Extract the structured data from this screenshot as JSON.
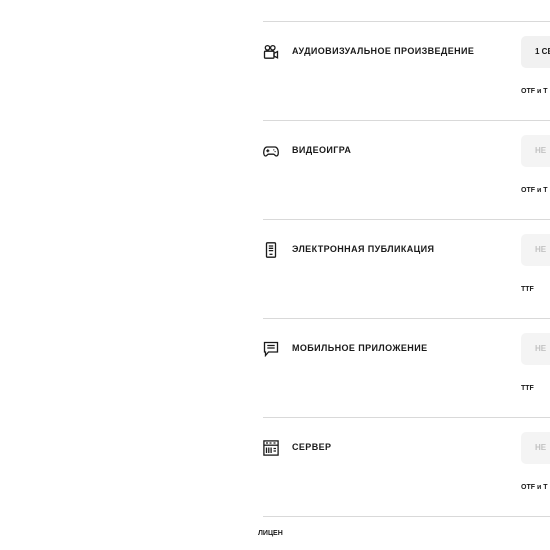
{
  "license_rows": [
    {
      "id": "audiovisual",
      "icon": "video-camera-icon",
      "label": "АУДИОВИЗУАЛЬНОЕ ПРОИЗВЕДЕНИЕ",
      "select_value": "1 СЕ",
      "select_disabled": false,
      "format": "OTF и T"
    },
    {
      "id": "videogame",
      "icon": "gamepad-icon",
      "label": "ВИДЕОИГРА",
      "select_value": "НЕ",
      "select_disabled": true,
      "format": "OTF и T"
    },
    {
      "id": "epublication",
      "icon": "ebook-reader-icon",
      "label": "ЭЛЕКТРОННАЯ ПУБЛИКАЦИЯ",
      "select_value": "НЕ",
      "select_disabled": true,
      "format": "TTF"
    },
    {
      "id": "mobile-app",
      "icon": "mobile-app-icon",
      "label": "МОБИЛЬНОЕ ПРИЛОЖЕНИЕ",
      "select_value": "НЕ",
      "select_disabled": true,
      "format": "TTF"
    },
    {
      "id": "server",
      "icon": "server-icon",
      "label": "СЕРВЕР",
      "select_value": "НЕ",
      "select_disabled": true,
      "format": "OTF и T"
    }
  ],
  "footer": {
    "label": "ЛИЦЕН"
  }
}
